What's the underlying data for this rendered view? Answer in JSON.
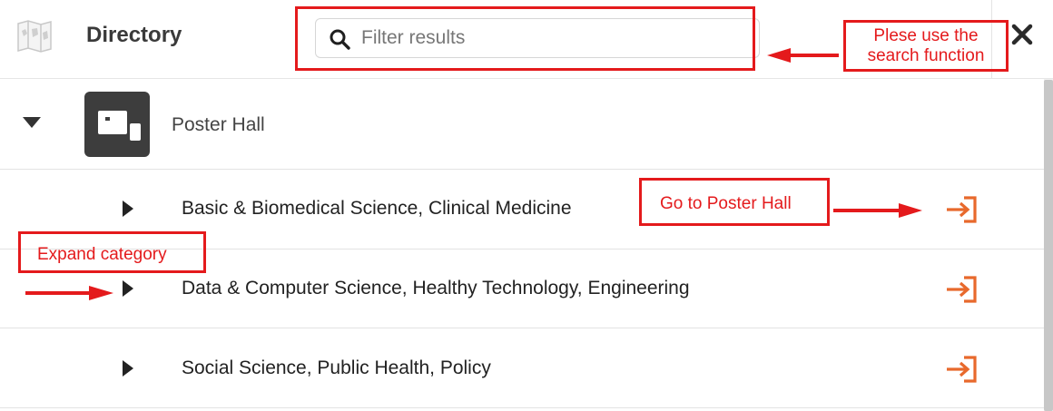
{
  "header": {
    "title": "Directory",
    "logo_icon": "map-icon",
    "close_icon": "close-icon"
  },
  "search": {
    "placeholder": "Filter results",
    "value": "",
    "icon": "search-icon"
  },
  "hall": {
    "label": "Poster Hall",
    "expanded": true,
    "icon": "poster-hall-icon"
  },
  "categories": [
    {
      "label": "Basic & Biomedical Science, Clinical Medicine"
    },
    {
      "label": "Data & Computer Science, Healthy Technology, Engineering"
    },
    {
      "label": "Social Science, Public Health, Policy"
    }
  ],
  "annotations": {
    "search_hint_line1": "Plese use the",
    "search_hint_line2": "search function",
    "goto_hint": "Go to Poster Hall",
    "expand_hint": "Expand category"
  },
  "colors": {
    "accent_orange": "#e8692c",
    "annotation_red": "#e41a1c",
    "thumb_dark": "#3d3d3d"
  }
}
